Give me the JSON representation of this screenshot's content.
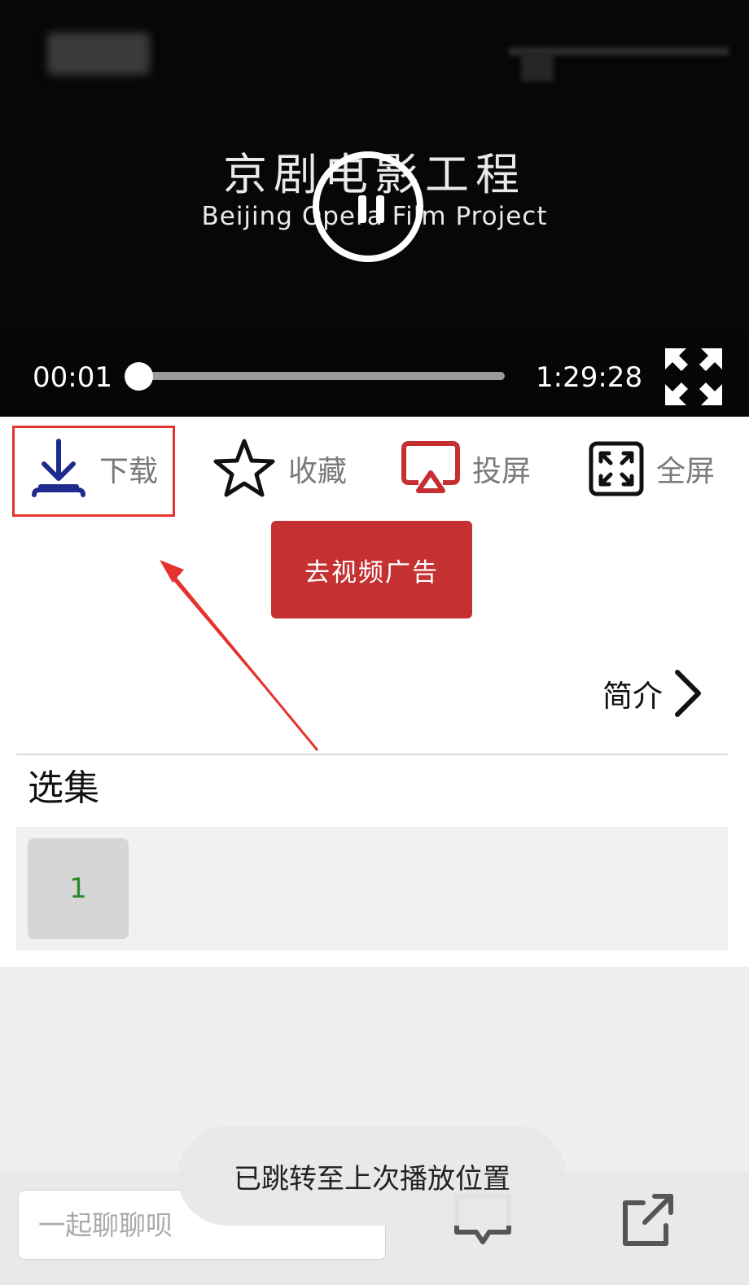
{
  "player": {
    "title_cn": "京剧电影工程",
    "title_en": "Beijing Opera Film Project",
    "current_time": "00:01",
    "duration": "1:29:28",
    "progress": 0.001
  },
  "actions": {
    "download": "下载",
    "favorite": "收藏",
    "cast": "投屏",
    "fullscreen": "全屏"
  },
  "ad_button": "去视频广告",
  "intro_label": "简介",
  "episodes": {
    "title": "选集",
    "items": [
      "1"
    ]
  },
  "chat": {
    "placeholder": "一起聊聊呗"
  },
  "toast": "已跳转至上次播放位置",
  "colors": {
    "download_icon": "#1f2b8c",
    "cast_icon": "#c62f32",
    "ad_button": "#c53133",
    "highlight": "#e5322d",
    "episode_text": "#2b8c2b"
  }
}
